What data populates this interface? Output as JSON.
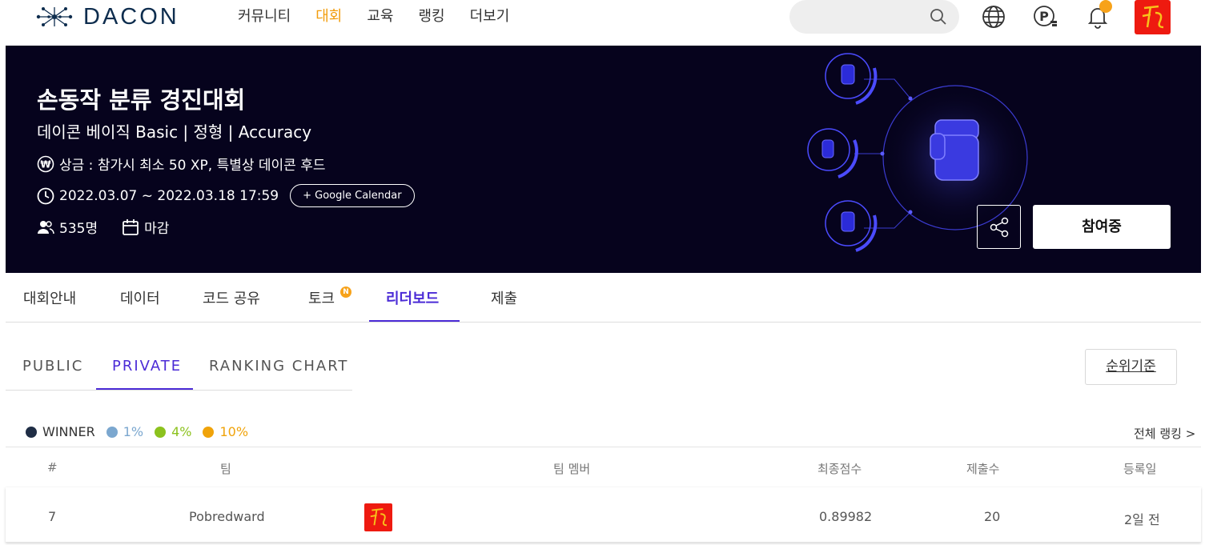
{
  "brand": {
    "name": "DACON"
  },
  "nav": [
    {
      "label": "커뮤니티",
      "active": false
    },
    {
      "label": "대회",
      "active": true
    },
    {
      "label": "교육",
      "active": false
    },
    {
      "label": "랭킹",
      "active": false
    },
    {
      "label": "더보기",
      "active": false
    }
  ],
  "search": {
    "placeholder": ""
  },
  "colors": {
    "accent": "#4b2bd6",
    "nav_active": "#f29d0c",
    "banner_bg": "#06031d",
    "avatar_red": "#ee1a10",
    "notify": "#f7a21a"
  },
  "icons": [
    "search-icon",
    "globe-icon",
    "point-icon",
    "bell-icon",
    "share-icon",
    "prize-icon",
    "clock-icon",
    "people-icon",
    "calendar-icon"
  ],
  "banner": {
    "title": "손동작 분류 경진대회",
    "subtitle": "데이콘 베이직 Basic | 정형 | Accuracy",
    "prize": "상금 : 참가시 최소 50 XP, 특별상 데이콘 후드",
    "period": "2022.03.07 ~ 2022.03.18 17:59",
    "calendar_button": "+ Google Calendar",
    "participants": "535명",
    "status": "마감",
    "join_button": "참여중"
  },
  "tabs": [
    {
      "label": "대회안내",
      "active": false
    },
    {
      "label": "데이터",
      "active": false
    },
    {
      "label": "코드 공유",
      "active": false
    },
    {
      "label": "토크",
      "active": false,
      "badge": "N"
    },
    {
      "label": "리더보드",
      "active": true
    },
    {
      "label": "제출",
      "active": false
    }
  ],
  "subtabs": [
    {
      "label": "PUBLIC",
      "active": false
    },
    {
      "label": "PRIVATE",
      "active": true
    },
    {
      "label": "RANKING CHART",
      "active": false
    }
  ],
  "rank_criteria_button": "순위기준",
  "legend": [
    {
      "label": "WINNER",
      "color": "#1f2d45"
    },
    {
      "label": "1%",
      "color": "#7ba7cf"
    },
    {
      "label": "4%",
      "color": "#8cc21e"
    },
    {
      "label": "10%",
      "color": "#f0a30a"
    }
  ],
  "all_ranking_link": "전체 랭킹 >",
  "table": {
    "headers": {
      "rank": "#",
      "team": "팀",
      "members": "팀 멤버",
      "score": "최종점수",
      "submissions": "제출수",
      "date": "등록일"
    },
    "rows": [
      {
        "rank": "7",
        "team": "Pobredward",
        "score": "0.89982",
        "submissions": "20",
        "date": "2일 전"
      }
    ]
  }
}
